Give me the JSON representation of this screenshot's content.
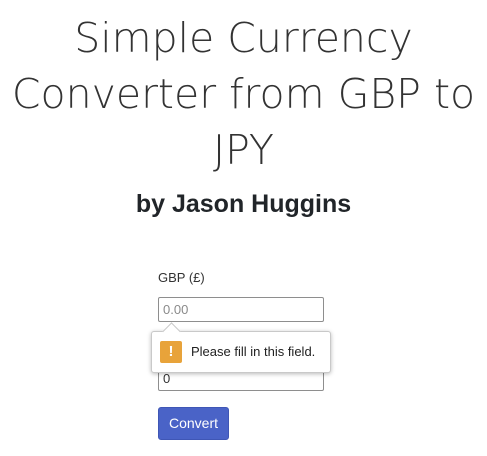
{
  "header": {
    "title": "Simple Currency Converter from GBP to JPY",
    "subtitle": "by Jason Huggins"
  },
  "form": {
    "gbp_label": "GBP (£)",
    "gbp_placeholder": "0.00",
    "gbp_value": "",
    "jpy_value": "0",
    "convert_label": "Convert"
  },
  "validation": {
    "message": "Please fill in this field.",
    "icon": "warning-icon",
    "icon_glyph": "!",
    "icon_color": "#e8a33a"
  },
  "colors": {
    "button": "#4a63c7"
  }
}
